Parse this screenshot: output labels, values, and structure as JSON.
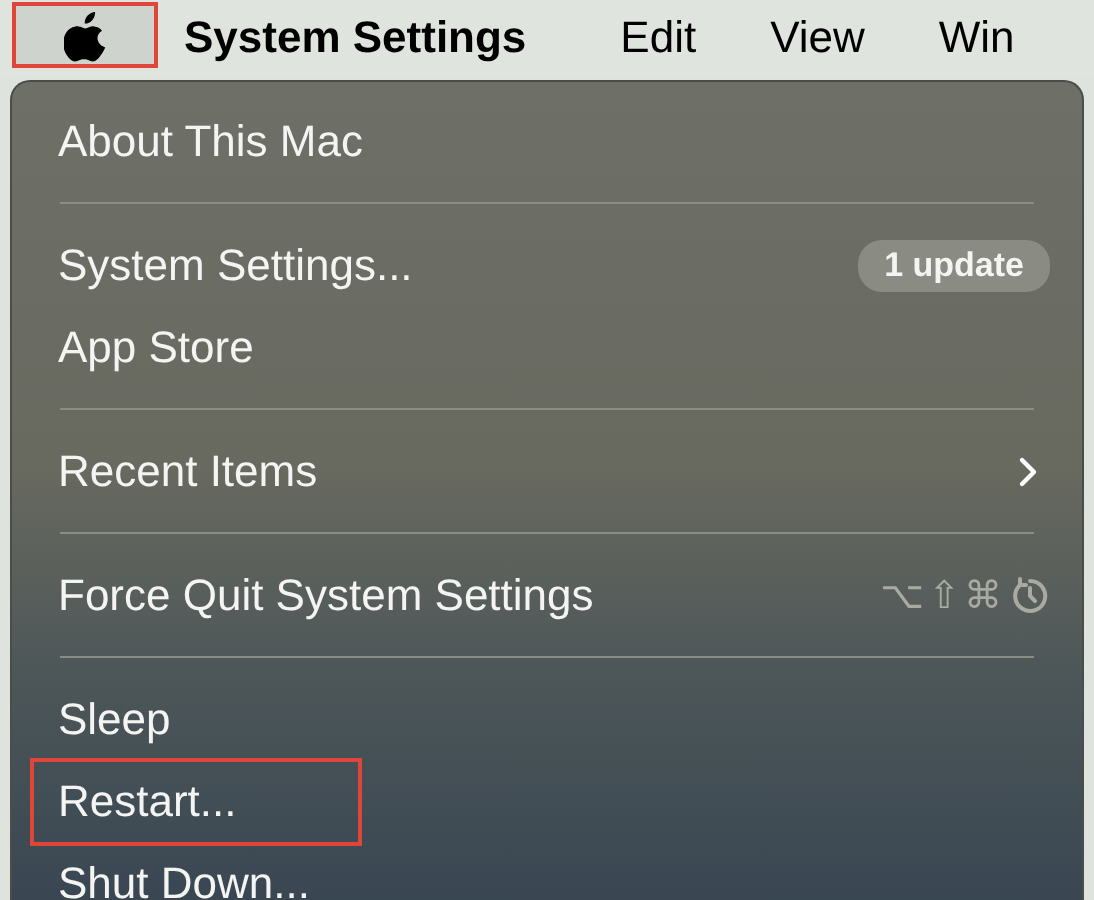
{
  "menu_bar": {
    "items": [
      {
        "kind": "apple",
        "annotated": true
      },
      {
        "kind": "app",
        "label": "System Settings"
      },
      {
        "kind": "menu",
        "label": "Edit"
      },
      {
        "kind": "menu",
        "label": "View"
      },
      {
        "kind": "menu",
        "label": "Win"
      }
    ]
  },
  "apple_menu": {
    "items": [
      {
        "kind": "item",
        "label": "About This Mac",
        "annotated": false
      },
      {
        "kind": "divider"
      },
      {
        "kind": "item",
        "label": "System Settings...",
        "badge": "1 update",
        "annotated": false
      },
      {
        "kind": "item",
        "label": "App Store",
        "annotated": false
      },
      {
        "kind": "divider"
      },
      {
        "kind": "item",
        "label": "Recent Items",
        "submenu": true,
        "annotated": false
      },
      {
        "kind": "divider"
      },
      {
        "kind": "item",
        "label": "Force Quit System Settings",
        "shortcut": "⌥⇧⌘",
        "annotated": false
      },
      {
        "kind": "divider"
      },
      {
        "kind": "item",
        "label": "Sleep",
        "annotated": false
      },
      {
        "kind": "item",
        "label": "Restart...",
        "annotated": true
      },
      {
        "kind": "item",
        "label": "Shut Down...",
        "annotated": false
      }
    ]
  }
}
